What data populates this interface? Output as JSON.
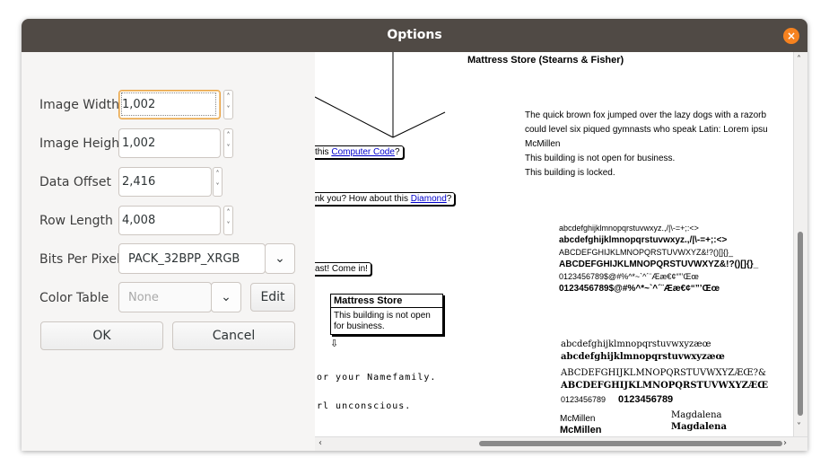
{
  "window": {
    "title": "Options",
    "close_glyph": "×"
  },
  "form": {
    "image_width": {
      "label": "Image Width",
      "value": "1,002"
    },
    "image_height": {
      "label": "Image Height",
      "value": "1,002"
    },
    "data_offset": {
      "label": "Data Offset",
      "value": "2,416"
    },
    "row_length": {
      "label": "Row Length",
      "value": "4,008"
    },
    "bits_per_pixel": {
      "label": "Bits Per Pixel",
      "value": "PACK_32BPP_XRGB"
    },
    "color_table": {
      "label": "Color Table",
      "value": "None",
      "edit_label": "Edit"
    },
    "ok_label": "OK",
    "cancel_label": "Cancel"
  },
  "preview": {
    "heading": "Mattress Store (Stearns & Fisher)",
    "bubble1_text": "this",
    "bubble1_link": "Computer Code",
    "bubble1_end": "?",
    "bubble2_text": "nk you? How about this",
    "bubble2_link": "Diamond",
    "bubble2_end": "?",
    "bubble3_text": "ast! Come in!",
    "popup_title": "Mattress Store",
    "popup_body": "This building is not open for business.",
    "mono1": "or your Namefamily.",
    "mono2": "rl unconscious.",
    "para_lines": [
      "The quick brown fox jumped over the lazy dogs with a razorb",
      "could level six piqued gymnasts who speak Latin: Lorem ipsu",
      "McMillen",
      "This building is not open for business.",
      "This building is locked."
    ],
    "font_block1": [
      "abcdefghijklmnopqrstuvwxyz.,/|\\-=+;:<>",
      "abcdefghijklmnopqrstuvwxyz.,/|\\-=+;:<>",
      "ABCDEFGHIJKLMNOPQRSTUVWXYZ&!?()[]{}_",
      "ABCDEFGHIJKLMNOPQRSTUVWXYZ&!?()[]{}_",
      "0123456789$@#%^*~`^´¨Ææ€¢“”’Œœ",
      "0123456789$@#%^*~`^´¨Ææ€¢“”’Œœ"
    ],
    "font_block2": [
      "abcdefghijklmnopqrstuvwxyzæœ",
      "abcdefghijklmnopqrstuvwxyzæœ",
      "ABCDEFGHIJKLMNOPQRSTUVWXYZÆŒ?&",
      "ABCDEFGHIJKLMNOPQRSTUVWXYZÆŒ",
      "0123456789",
      "0123456789"
    ],
    "name1": "McMillen",
    "name1b": "McMillen",
    "name2": "Magdalena",
    "name2b": "Magdalena"
  }
}
